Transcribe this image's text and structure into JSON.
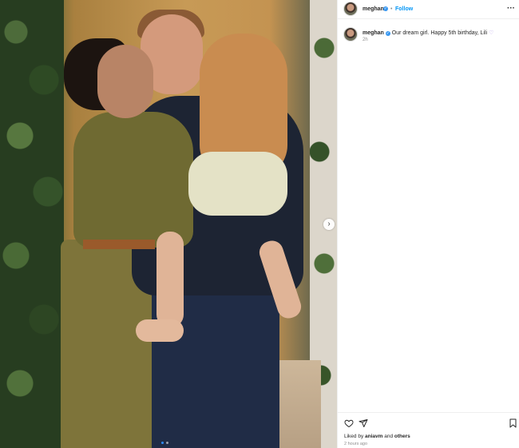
{
  "post": {
    "username": "meghan",
    "separator": "•",
    "follow_label": "Follow",
    "more_label": "···",
    "caption": "Our dream girl. Happy 5th birthday, Lili",
    "caption_emoji": "♡",
    "time_ago": "2h",
    "likes_prefix": "Liked by",
    "liked_by_user": "aniavm",
    "likes_joiner": "and",
    "likes_others": "others",
    "date_label": "2 hours ago"
  },
  "carousel": {
    "next_symbol": "›",
    "slide_count": 2,
    "active_index": 0
  },
  "colors": {
    "accent_blue": "#0095f6",
    "verified_blue": "#3897f0",
    "muted_text": "#8e8e8e"
  },
  "icons": {
    "like": "heart-outline-icon",
    "share": "paper-plane-icon",
    "save": "bookmark-icon",
    "verified": "verified-badge-icon",
    "next": "chevron-right-icon"
  }
}
